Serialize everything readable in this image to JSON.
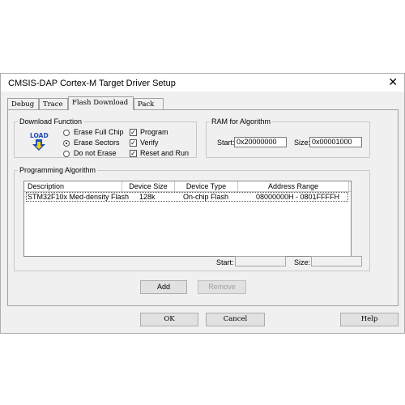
{
  "window": {
    "title": "CMSIS-DAP Cortex-M Target Driver Setup",
    "close_glyph": "✕"
  },
  "tabs": [
    {
      "label": "Debug"
    },
    {
      "label": "Trace"
    },
    {
      "label": "Flash Download"
    },
    {
      "label": "Pack"
    }
  ],
  "download_function": {
    "legend": "Download Function",
    "icon_text": "LOAD",
    "radios": [
      {
        "label": "Erase Full Chip",
        "selected": false
      },
      {
        "label": "Erase Sectors",
        "selected": true
      },
      {
        "label": "Do not Erase",
        "selected": false
      }
    ],
    "checks": [
      {
        "label": "Program",
        "checked": true
      },
      {
        "label": "Verify",
        "checked": true
      },
      {
        "label": "Reset and Run",
        "checked": true
      }
    ]
  },
  "ram": {
    "legend": "RAM for Algorithm",
    "start_label": "Start:",
    "start_value": "0x20000000",
    "size_label": "Size:",
    "size_value": "0x00001000"
  },
  "programming_algorithm": {
    "legend": "Programming Algorithm",
    "columns": [
      "Description",
      "Device Size",
      "Device Type",
      "Address Range"
    ],
    "rows": [
      [
        "STM32F10x Med-density Flash",
        "128k",
        "On-chip Flash",
        "08000000H - 0801FFFFH"
      ]
    ],
    "start_label": "Start:",
    "start_value": "",
    "size_label": "Size:",
    "size_value": ""
  },
  "buttons": {
    "add": "Add",
    "remove": "Remove",
    "ok": "OK",
    "cancel": "Cancel",
    "help": "Help"
  },
  "colors": {
    "dialog_bg": "#f0f0f0",
    "icon_blue": "#1c4fb8",
    "icon_yellow": "#f5d000"
  }
}
